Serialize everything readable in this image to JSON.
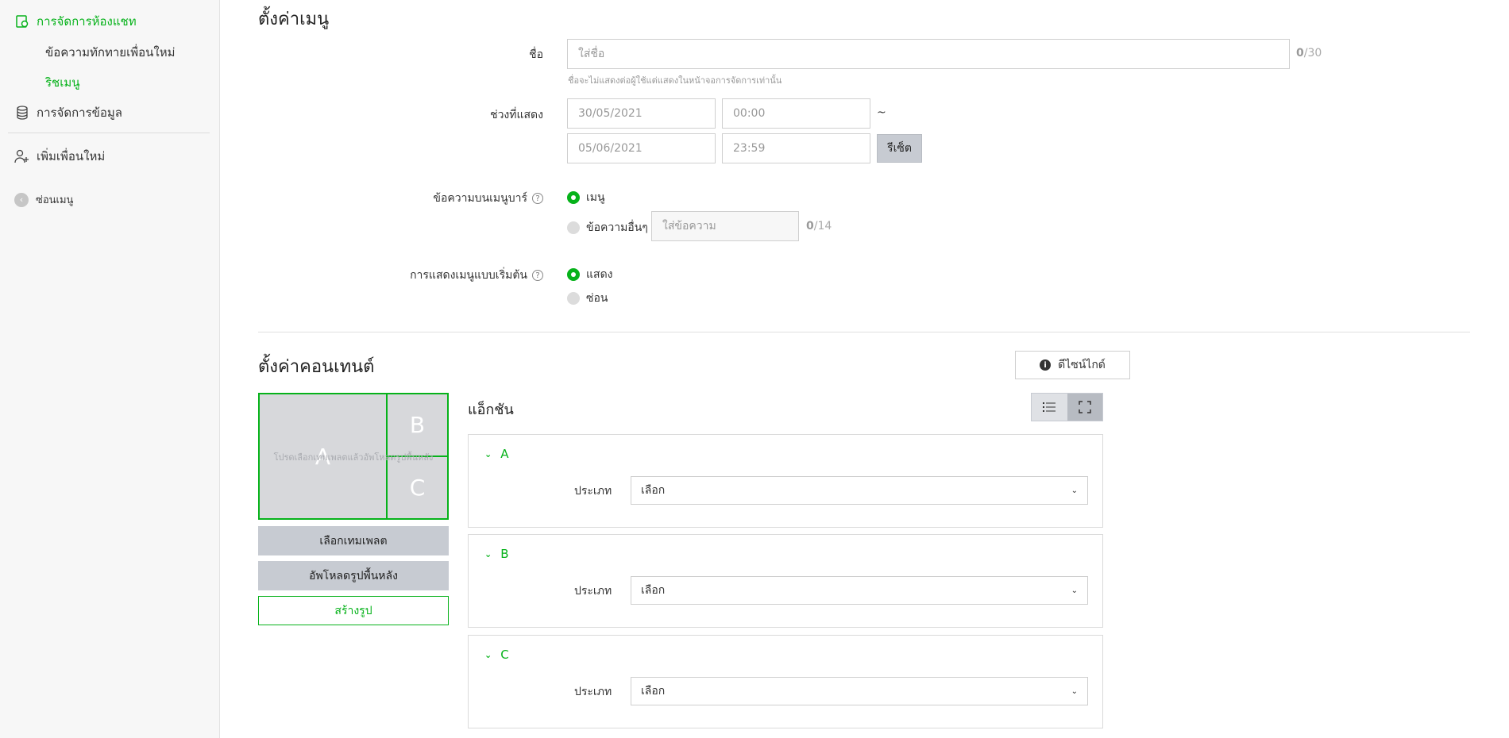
{
  "sidebar": {
    "chat_management": "การจัดการห้องแชท",
    "greeting_message": "ข้อความทักทายเพื่อนใหม่",
    "rich_menu": "ริชเมนู",
    "data_management": "การจัดการข้อมูล",
    "add_friends": "เพิ่มเพื่อนใหม่",
    "hide_menu": "ซ่อนเมนู"
  },
  "menu_settings": {
    "title": "ตั้งค่าเมนู",
    "name_label": "ชื่อ",
    "name_placeholder": "ใส่ชื่อ",
    "name_count": "0",
    "name_max": "/30",
    "name_hint": "ชื่อจะไม่แสดงต่อผู้ใช้แต่แสดงในหน้าจอการจัดการเท่านั้น",
    "period_label": "ช่วงที่แสดง",
    "start_date": "30/05/2021",
    "start_time": "00:00",
    "tilde": "~",
    "end_date": "05/06/2021",
    "end_time": "23:59",
    "reset_label": "รีเซ็ต",
    "menubar_label": "ข้อความบนเมนูบาร์",
    "menubar_option_menu": "เมนู",
    "menubar_option_other": "ข้อความอื่นๆ",
    "menubar_text_placeholder": "ใส่ข้อความ",
    "menubar_count": "0",
    "menubar_max": "/14",
    "default_label": "การแสดงเมนูแบบเริ่มต้น",
    "default_show": "แสดง",
    "default_hide": "ซ่อน",
    "help_glyph": "?"
  },
  "content_settings": {
    "title": "ตั้งค่าคอนเทนต์",
    "design_guide": "ดีไซน์ไกด์",
    "info_glyph": "i",
    "preview_note": "โปรดเลือกเทมเพลตแล้วอัพโหลดรูปพื้นหลัง",
    "cell_a": "A",
    "cell_b": "B",
    "cell_c": "C",
    "select_template": "เลือกเทมเพลต",
    "upload_background": "อัพโหลดรูปพื้นหลัง",
    "create_image": "สร้างรูป",
    "action_title": "แอ็กชัน",
    "panels": [
      {
        "title": "A",
        "type_label": "ประเภท",
        "type_value": "เลือก"
      },
      {
        "title": "B",
        "type_label": "ประเภท",
        "type_value": "เลือก"
      },
      {
        "title": "C",
        "type_label": "ประเภท",
        "type_value": "เลือก"
      }
    ]
  },
  "icons": {
    "chat": "chat-management-icon",
    "database": "database-icon",
    "add_user": "add-user-icon",
    "collapse": "collapse-left-icon",
    "list_view": "list-view-icon",
    "fullscreen": "fullscreen-icon",
    "chevron": "chevron-down-icon"
  },
  "colors": {
    "accent": "#06b21a",
    "button_grey": "#c7cbd2"
  }
}
